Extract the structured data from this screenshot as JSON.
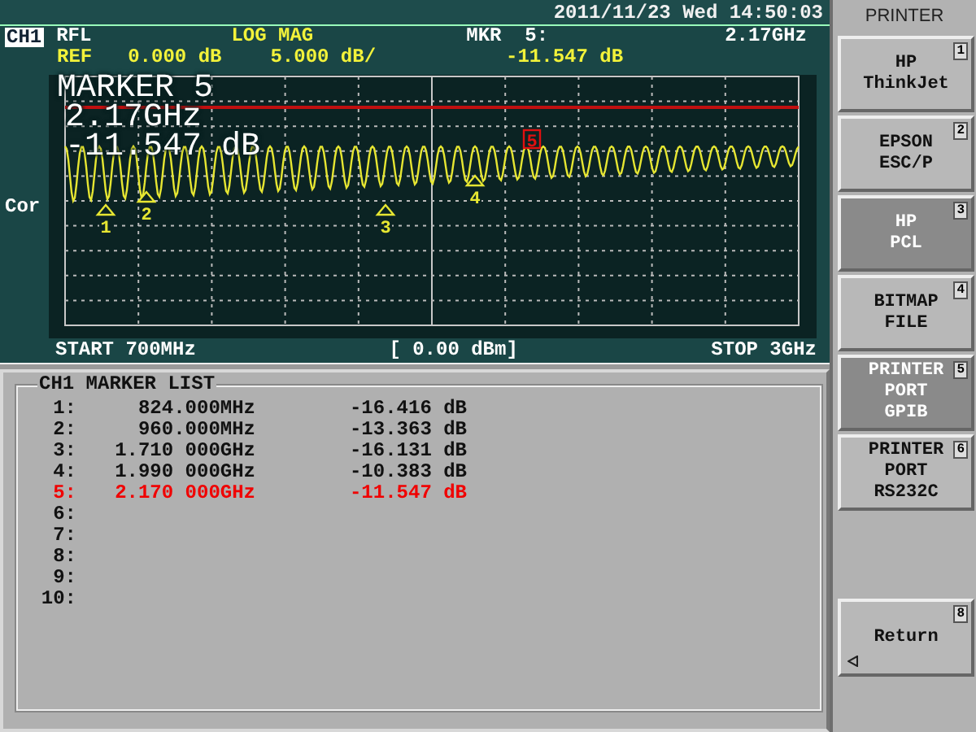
{
  "status_bar": {
    "datetime": "2011/11/23 Wed 14:50:03"
  },
  "channel": {
    "label": "CH1",
    "measurement": "RFL",
    "format": "LOG MAG",
    "marker_label": "MKR  5:",
    "marker_frequency": "2.17GHz",
    "reference_label": "REF",
    "reference_value": "0.000 dB",
    "scale": "5.000 dB/",
    "marker_value": "-11.547 dB"
  },
  "side_label": "Cor",
  "marker_readout": [
    "MARKER 5",
    "2.17GHz",
    "-11.547 dB"
  ],
  "trace_markers": [
    {
      "label": "1",
      "selected": false
    },
    {
      "label": "2",
      "selected": false
    },
    {
      "label": "3",
      "selected": false
    },
    {
      "label": "4",
      "selected": false
    },
    {
      "label": "5",
      "selected": true
    }
  ],
  "footer": {
    "start": "START 700MHz",
    "power": "[ 0.00 dBm]",
    "stop": "STOP 3GHz"
  },
  "marker_list": {
    "title": "CH1 MARKER LIST",
    "rows": [
      {
        "number": "1:",
        "frequency": "824.000MHz",
        "value": "-16.416 dB",
        "selected": false
      },
      {
        "number": "2:",
        "frequency": "960.000MHz",
        "value": "-13.363 dB",
        "selected": false
      },
      {
        "number": "3:",
        "frequency": "1.710 000GHz",
        "value": "-16.131 dB",
        "selected": false
      },
      {
        "number": "4:",
        "frequency": "1.990 000GHz",
        "value": "-10.383 dB",
        "selected": false
      },
      {
        "number": "5:",
        "frequency": "2.170 000GHz",
        "value": "-11.547 dB",
        "selected": true
      },
      {
        "number": "6:",
        "selected": false
      },
      {
        "number": "7:",
        "selected": false
      },
      {
        "number": "8:",
        "selected": false
      },
      {
        "number": "9:",
        "selected": false
      },
      {
        "number": "10:",
        "selected": false
      }
    ]
  },
  "softkey_menu": {
    "title": "PRINTER",
    "keys": [
      {
        "kind": "option",
        "lines": [
          "HP",
          "ThinkJet"
        ],
        "number": "1",
        "selected": false
      },
      {
        "kind": "option",
        "lines": [
          "EPSON",
          "ESC/P"
        ],
        "number": "2",
        "selected": false
      },
      {
        "kind": "option",
        "lines": [
          "HP",
          "PCL"
        ],
        "number": "3",
        "selected": true
      },
      {
        "kind": "option",
        "lines": [
          "BITMAP",
          "FILE"
        ],
        "number": "4",
        "selected": false
      },
      {
        "kind": "option",
        "lines": [
          "PRINTER",
          "PORT",
          "GPIB"
        ],
        "number": "5",
        "selected": true
      },
      {
        "kind": "option",
        "lines": [
          "PRINTER",
          "PORT",
          "RS232C"
        ],
        "number": "6",
        "selected": false
      },
      {
        "kind": "return",
        "lines": [
          "Return"
        ],
        "number": "8",
        "selected": false
      }
    ]
  }
}
